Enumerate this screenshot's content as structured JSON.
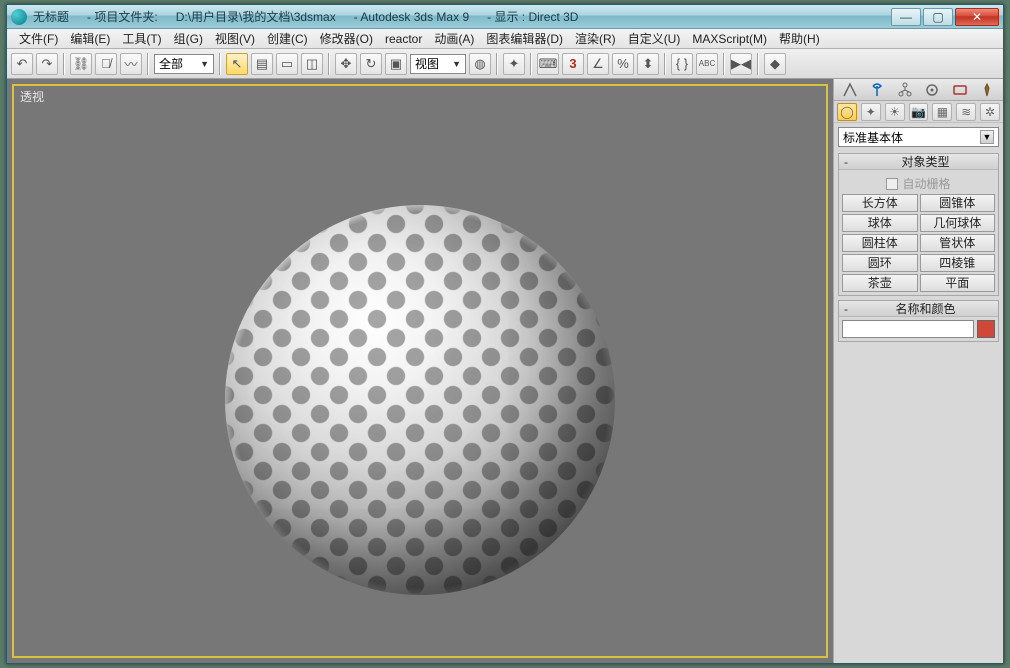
{
  "title": {
    "doc": "无标题",
    "project_label": "- 项目文件夹:",
    "project_path": "D:\\用户目录\\我的文档\\3dsmax",
    "app": "- Autodesk 3ds Max 9",
    "display": "- 显示 : Direct 3D"
  },
  "menus": {
    "file": "文件(F)",
    "edit": "编辑(E)",
    "tools": "工具(T)",
    "group": "组(G)",
    "views": "视图(V)",
    "create": "创建(C)",
    "modifiers": "修改器(O)",
    "reactor": "reactor",
    "animation": "动画(A)",
    "graph": "图表编辑器(D)",
    "rendering": "渲染(R)",
    "customize": "自定义(U)",
    "maxscript": "MAXScript(M)",
    "help": "帮助(H)"
  },
  "toolbar": {
    "selection_set": "全部",
    "view_dropdown": "视图"
  },
  "viewport": {
    "label": "透视"
  },
  "panel": {
    "category": "标准基本体",
    "rollout_type": "对象类型",
    "autogrid": "自动栅格",
    "primitives": {
      "box": "长方体",
      "cone": "圆锥体",
      "sphere": "球体",
      "geosphere": "几何球体",
      "cylinder": "圆柱体",
      "tube": "管状体",
      "torus": "圆环",
      "pyramid": "四棱锥",
      "teapot": "茶壶",
      "plane": "平面"
    },
    "rollout_namecolor": "名称和颜色"
  }
}
